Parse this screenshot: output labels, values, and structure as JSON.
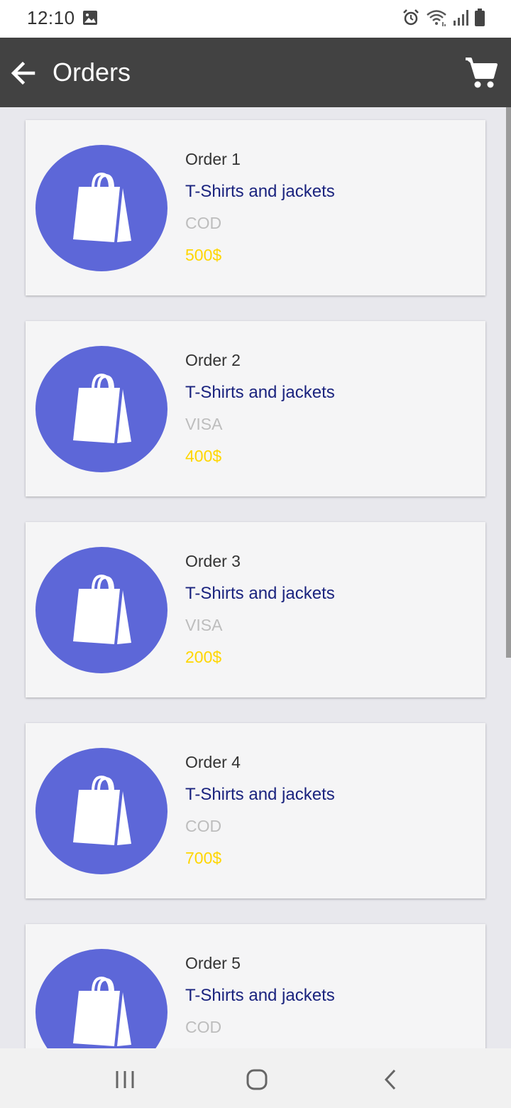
{
  "status_bar": {
    "time": "12:10",
    "icons": [
      "image-icon",
      "alarm-icon",
      "wifi-icon",
      "signal-icon",
      "battery-icon"
    ]
  },
  "app_bar": {
    "title": "Orders",
    "back_icon": "arrow-back-icon",
    "cart_icon": "shopping-cart-icon",
    "background": "#424242"
  },
  "orders": [
    {
      "name": "Order 1",
      "description": "T-Shirts and jackets",
      "payment": "COD",
      "amount": "500$"
    },
    {
      "name": "Order 2",
      "description": "T-Shirts and jackets",
      "payment": "VISA",
      "amount": "400$"
    },
    {
      "name": "Order 3",
      "description": "T-Shirts and jackets",
      "payment": "VISA",
      "amount": "200$"
    },
    {
      "name": "Order 4",
      "description": "T-Shirts and jackets",
      "payment": "COD",
      "amount": "700$"
    },
    {
      "name": "Order 5",
      "description": "T-Shirts and jackets",
      "payment": "COD",
      "amount": ""
    }
  ],
  "colors": {
    "avatar": "#5d67d8",
    "description": "#1a237e",
    "payment": "#bdbdbd",
    "amount": "#ffd600"
  },
  "nav_bar": {
    "icons": [
      "recent-apps-icon",
      "home-icon",
      "back-icon"
    ]
  }
}
